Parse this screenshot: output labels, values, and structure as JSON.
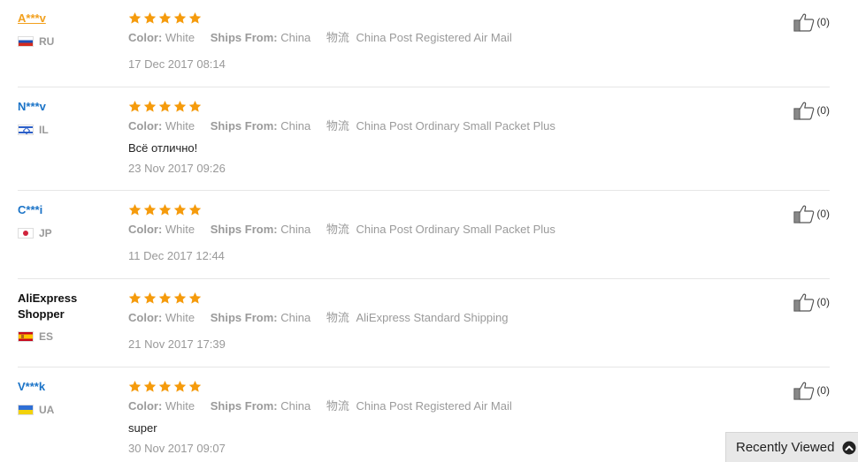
{
  "reviews": [
    {
      "user": "A***v",
      "user_style": "highlight",
      "country": "RU",
      "flag": "ru",
      "stars": 5,
      "color_label": "Color:",
      "color": "White",
      "ships_label": "Ships From:",
      "ships": "China",
      "logistics_label": "物流",
      "logistics": "China Post Registered Air Mail",
      "comment": "",
      "date": "17 Dec 2017 08:14",
      "helpful": "(0)"
    },
    {
      "user": "N***v",
      "user_style": "link",
      "country": "IL",
      "flag": "il",
      "stars": 5,
      "color_label": "Color:",
      "color": "White",
      "ships_label": "Ships From:",
      "ships": "China",
      "logistics_label": "物流",
      "logistics": "China Post Ordinary Small Packet Plus",
      "comment": "Всё отлично!",
      "date": "23 Nov 2017 09:26",
      "helpful": "(0)"
    },
    {
      "user": "C***i",
      "user_style": "link",
      "country": "JP",
      "flag": "jp",
      "stars": 5,
      "color_label": "Color:",
      "color": "White",
      "ships_label": "Ships From:",
      "ships": "China",
      "logistics_label": "物流",
      "logistics": "China Post Ordinary Small Packet Plus",
      "comment": "",
      "date": "11 Dec 2017 12:44",
      "helpful": "(0)"
    },
    {
      "user": "AliExpress Shopper",
      "user_style": "plain",
      "country": "ES",
      "flag": "es",
      "stars": 5,
      "color_label": "Color:",
      "color": "White",
      "ships_label": "Ships From:",
      "ships": "China",
      "logistics_label": "物流",
      "logistics": "AliExpress Standard Shipping",
      "comment": "",
      "date": "21 Nov 2017 17:39",
      "helpful": "(0)"
    },
    {
      "user": "V***k",
      "user_style": "link",
      "country": "UA",
      "flag": "ua",
      "stars": 5,
      "color_label": "Color:",
      "color": "White",
      "ships_label": "Ships From:",
      "ships": "China",
      "logistics_label": "物流",
      "logistics": "China Post Registered Air Mail",
      "comment": "super",
      "date": "30 Nov 2017 09:07",
      "helpful": "(0)"
    }
  ],
  "icons": {
    "star": "star-icon",
    "helpful": "thumbs-up-icon",
    "recent": "chevron-up-icon"
  },
  "colors": {
    "star": "#f59b0c",
    "link": "#1a73c7",
    "highlight": "#f2a01d"
  },
  "recently_viewed": {
    "label": "Recently Viewed"
  }
}
